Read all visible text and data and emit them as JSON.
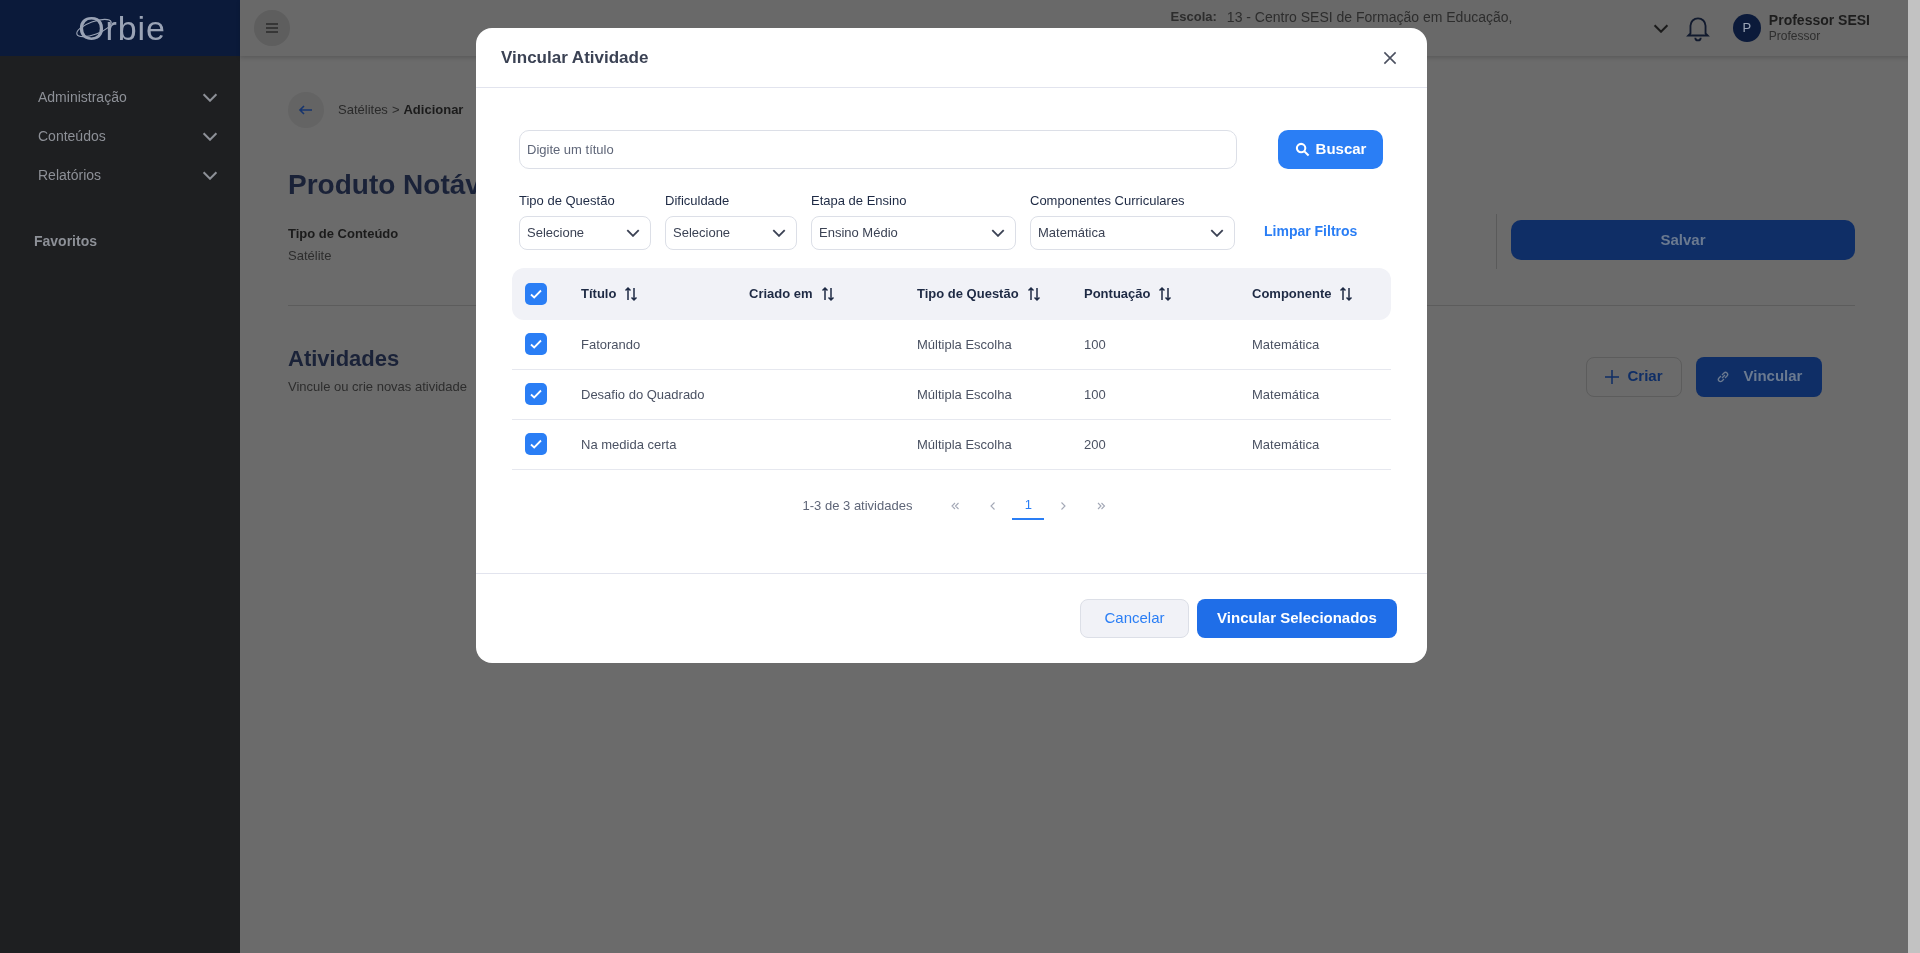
{
  "app": {
    "logo": "Orbie"
  },
  "sidebar": {
    "items": [
      {
        "label": "Administração",
        "expanded": false
      },
      {
        "label": "Conteúdos",
        "expanded": false
      },
      {
        "label": "Relatórios",
        "expanded": false
      }
    ],
    "favorites_heading": "Favoritos"
  },
  "header": {
    "school_label": "Escola:",
    "school": "13 - Centro SESI de Formação em Educação,",
    "user": {
      "initial": "P",
      "name": "Professor SESI",
      "role": "Professor"
    }
  },
  "page": {
    "breadcrumb": [
      "Satélites",
      "Adicionar"
    ],
    "breadcrumb_separator": ">",
    "title": "Produto Notáv",
    "content_type_label": "Tipo de Conteúdo",
    "content_type": "Satélite",
    "save_button": "Salvar",
    "section_title": "Atividades",
    "section_subtitle": "Vincule ou crie novas atividade",
    "create_button": "Criar",
    "link_button": "Vincular"
  },
  "modal": {
    "title": "Vincular Atividade",
    "search": {
      "placeholder": "Digite um título"
    },
    "search_button": "Buscar",
    "filters": [
      {
        "label": "Tipo de Questão",
        "value": "Selecione"
      },
      {
        "label": "Dificuldade",
        "value": "Selecione"
      },
      {
        "label": "Etapa de Ensino",
        "value": "Ensino Médio"
      },
      {
        "label": "Componentes Curriculares",
        "value": "Matemática"
      }
    ],
    "clear_filters": "Limpar Filtros",
    "table": {
      "all_checked": true,
      "columns": [
        "Título",
        "Criado em",
        "Tipo de Questão",
        "Pontuação",
        "Componente"
      ],
      "rows": [
        {
          "checked": true,
          "cells": [
            "Fatorando",
            "",
            "Múltipla Escolha",
            "100",
            "Matemática"
          ]
        },
        {
          "checked": true,
          "cells": [
            "Desafio do Quadrado",
            "",
            "Múltipla Escolha",
            "100",
            "Matemática"
          ]
        },
        {
          "checked": true,
          "cells": [
            "Na medida certa",
            "",
            "Múltipla Escolha",
            "200",
            "Matemática"
          ]
        }
      ]
    },
    "pagination": {
      "summary": "1-3 de 3 atividades",
      "pages": [
        {
          "label": "1",
          "selected": true
        }
      ]
    },
    "cancel_button": "Cancelar",
    "confirm_button": "Vincular Selecionados"
  }
}
